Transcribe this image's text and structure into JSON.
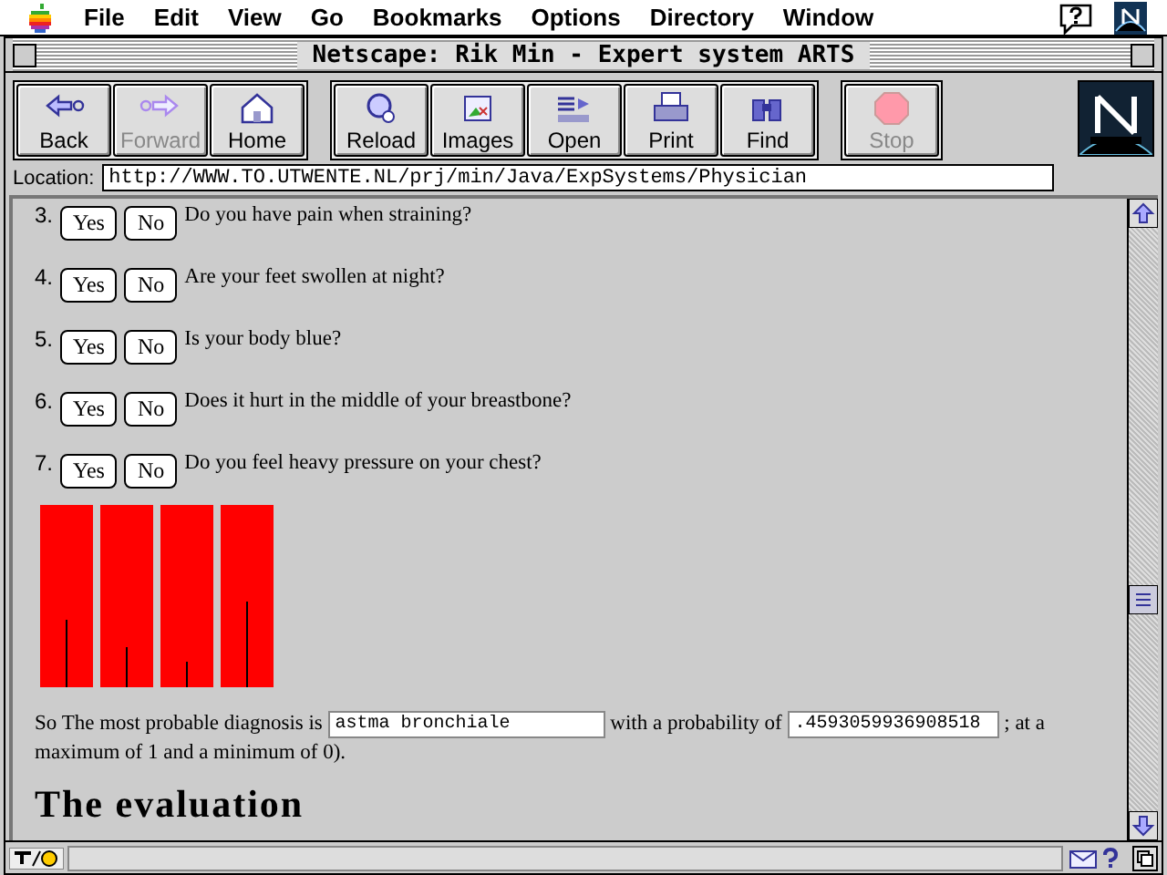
{
  "menu_bar": {
    "items": [
      "File",
      "Edit",
      "View",
      "Go",
      "Bookmarks",
      "Options",
      "Directory",
      "Window"
    ]
  },
  "window": {
    "title": "Netscape: Rik Min - Expert system ARTS"
  },
  "toolbar": {
    "groups": [
      [
        {
          "label": "Back",
          "kind": "back",
          "disabled": false
        },
        {
          "label": "Forward",
          "kind": "forward",
          "disabled": true
        },
        {
          "label": "Home",
          "kind": "home",
          "disabled": false
        }
      ],
      [
        {
          "label": "Reload",
          "kind": "reload",
          "disabled": false
        },
        {
          "label": "Images",
          "kind": "images",
          "disabled": false
        },
        {
          "label": "Open",
          "kind": "open",
          "disabled": false
        },
        {
          "label": "Print",
          "kind": "print",
          "disabled": false
        },
        {
          "label": "Find",
          "kind": "find",
          "disabled": false
        }
      ],
      [
        {
          "label": "Stop",
          "kind": "stop",
          "disabled": true
        }
      ]
    ]
  },
  "location": {
    "label": "Location:",
    "value": "http://WWW.TO.UTWENTE.NL/prj/min/Java/ExpSystems/Physician"
  },
  "questions": [
    {
      "number": "3.",
      "yes": "Yes",
      "no": "No",
      "text": "Do you have pain when straining?"
    },
    {
      "number": "4.",
      "yes": "Yes",
      "no": "No",
      "text": "Are your feet swollen at night?"
    },
    {
      "number": "5.",
      "yes": "Yes",
      "no": "No",
      "text": "Is your body blue?"
    },
    {
      "number": "6.",
      "yes": "Yes",
      "no": "No",
      "text": "Does it hurt in the middle of your breastbone?"
    },
    {
      "number": "7.",
      "yes": "Yes",
      "no": "No",
      "text": "Do you feel heavy pressure on your chest?"
    }
  ],
  "meters": [
    {
      "level": 0.37
    },
    {
      "level": 0.22
    },
    {
      "level": 0.14
    },
    {
      "level": 0.47
    }
  ],
  "diagnosis": {
    "before": "So The most probable diagnosis is",
    "diagnosis_value": "astma bronchiale",
    "middle": "with a probability of",
    "probability_value": ".4593059936908518",
    "after": "; at a",
    "after_continued": "maximum of 1 and a minimum of 0)."
  },
  "heading": "The evaluation"
}
